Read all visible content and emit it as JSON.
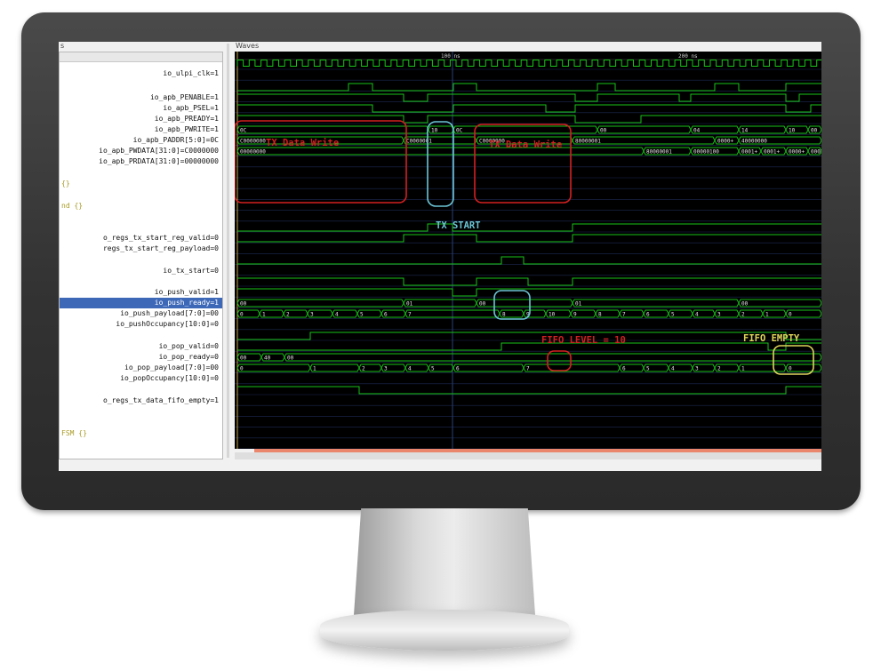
{
  "panels": {
    "signals_title": "s",
    "waves_title": "Waves"
  },
  "timeline": {
    "ticks": [
      "100 ns",
      "200 ns"
    ]
  },
  "signals": [
    {
      "label": "io_ulpi_clk=1",
      "type": "signal"
    },
    {
      "label": "io_apb_PENABLE=1",
      "type": "signal"
    },
    {
      "label": "io_apb_PSEL=1",
      "type": "signal"
    },
    {
      "label": "io_apb_PREADY=1",
      "type": "signal"
    },
    {
      "label": "io_apb_PWRITE=1",
      "type": "signal"
    },
    {
      "label": "io_apb_PADDR[5:0]=0C",
      "type": "signal"
    },
    {
      "label": "io_apb_PWDATA[31:0]=C0000000",
      "type": "signal"
    },
    {
      "label": "io_apb_PRDATA[31:0]=00000000",
      "type": "signal"
    },
    {
      "label": "{}",
      "type": "group"
    },
    {
      "label": "nd {}",
      "type": "group"
    },
    {
      "label": "o_regs_tx_start_reg_valid=0",
      "type": "signal"
    },
    {
      "label": "regs_tx_start_reg_payload=0",
      "type": "signal"
    },
    {
      "label": "io_tx_start=0",
      "type": "signal"
    },
    {
      "label": "io_push_valid=1",
      "type": "signal"
    },
    {
      "label": "io_push_ready=1",
      "type": "signal",
      "selected": true
    },
    {
      "label": "io_push_payload[7:0]=00",
      "type": "signal"
    },
    {
      "label": "io_pushOccupancy[10:0]=0",
      "type": "signal"
    },
    {
      "label": "io_pop_valid=0",
      "type": "signal"
    },
    {
      "label": "io_pop_ready=0",
      "type": "signal"
    },
    {
      "label": "io_pop_payload[7:0]=00",
      "type": "signal"
    },
    {
      "label": "io_popOccupancy[10:0]=0",
      "type": "signal"
    },
    {
      "label": "o_regs_tx_data_fifo_empty=1",
      "type": "signal"
    },
    {
      "label": "FSM {}",
      "type": "group"
    }
  ],
  "bus_values": {
    "paddr": [
      "0C",
      "10",
      "0C",
      "00",
      "04",
      "14",
      "10",
      "00"
    ],
    "pwdata": [
      "C0000000",
      "C0000001",
      "C0000000",
      "80000001",
      "0000+",
      "40000000"
    ],
    "prdata": [
      "00000000",
      "80000001",
      "00000100",
      "0001+",
      "0001+",
      "0000+",
      "0001"
    ],
    "push_payload": [
      "00",
      "01",
      "00",
      "01",
      "00"
    ],
    "push_occupancy": [
      "0",
      "1",
      "2",
      "3",
      "4",
      "5",
      "6",
      "7",
      "8",
      "9",
      "10",
      "9",
      "8",
      "7",
      "6",
      "5",
      "4",
      "3",
      "2",
      "1",
      "0"
    ],
    "pop_payload": [
      "00",
      "40",
      "00"
    ],
    "pop_occupancy": [
      "0",
      "1",
      "2",
      "3",
      "4",
      "5",
      "6",
      "7",
      "6",
      "5",
      "4",
      "3",
      "2",
      "1",
      "0"
    ]
  },
  "annotations": {
    "tx_write_1": "TX Data Write",
    "tx_write_2": "TX Data Write",
    "tx_start": "TX START",
    "fifo_level": "FIFO LEVEL = 10",
    "fifo_empty": "FIFO EMPTY"
  },
  "colors": {
    "wave": "#19c419",
    "bus_text": "#e6e6e6",
    "grid": "#1c2a55",
    "annotation_red": "#d42020",
    "annotation_cyan": "#6cc6d6",
    "annotation_yellow": "#e0d65a",
    "selected_row": "#3d68b8"
  }
}
